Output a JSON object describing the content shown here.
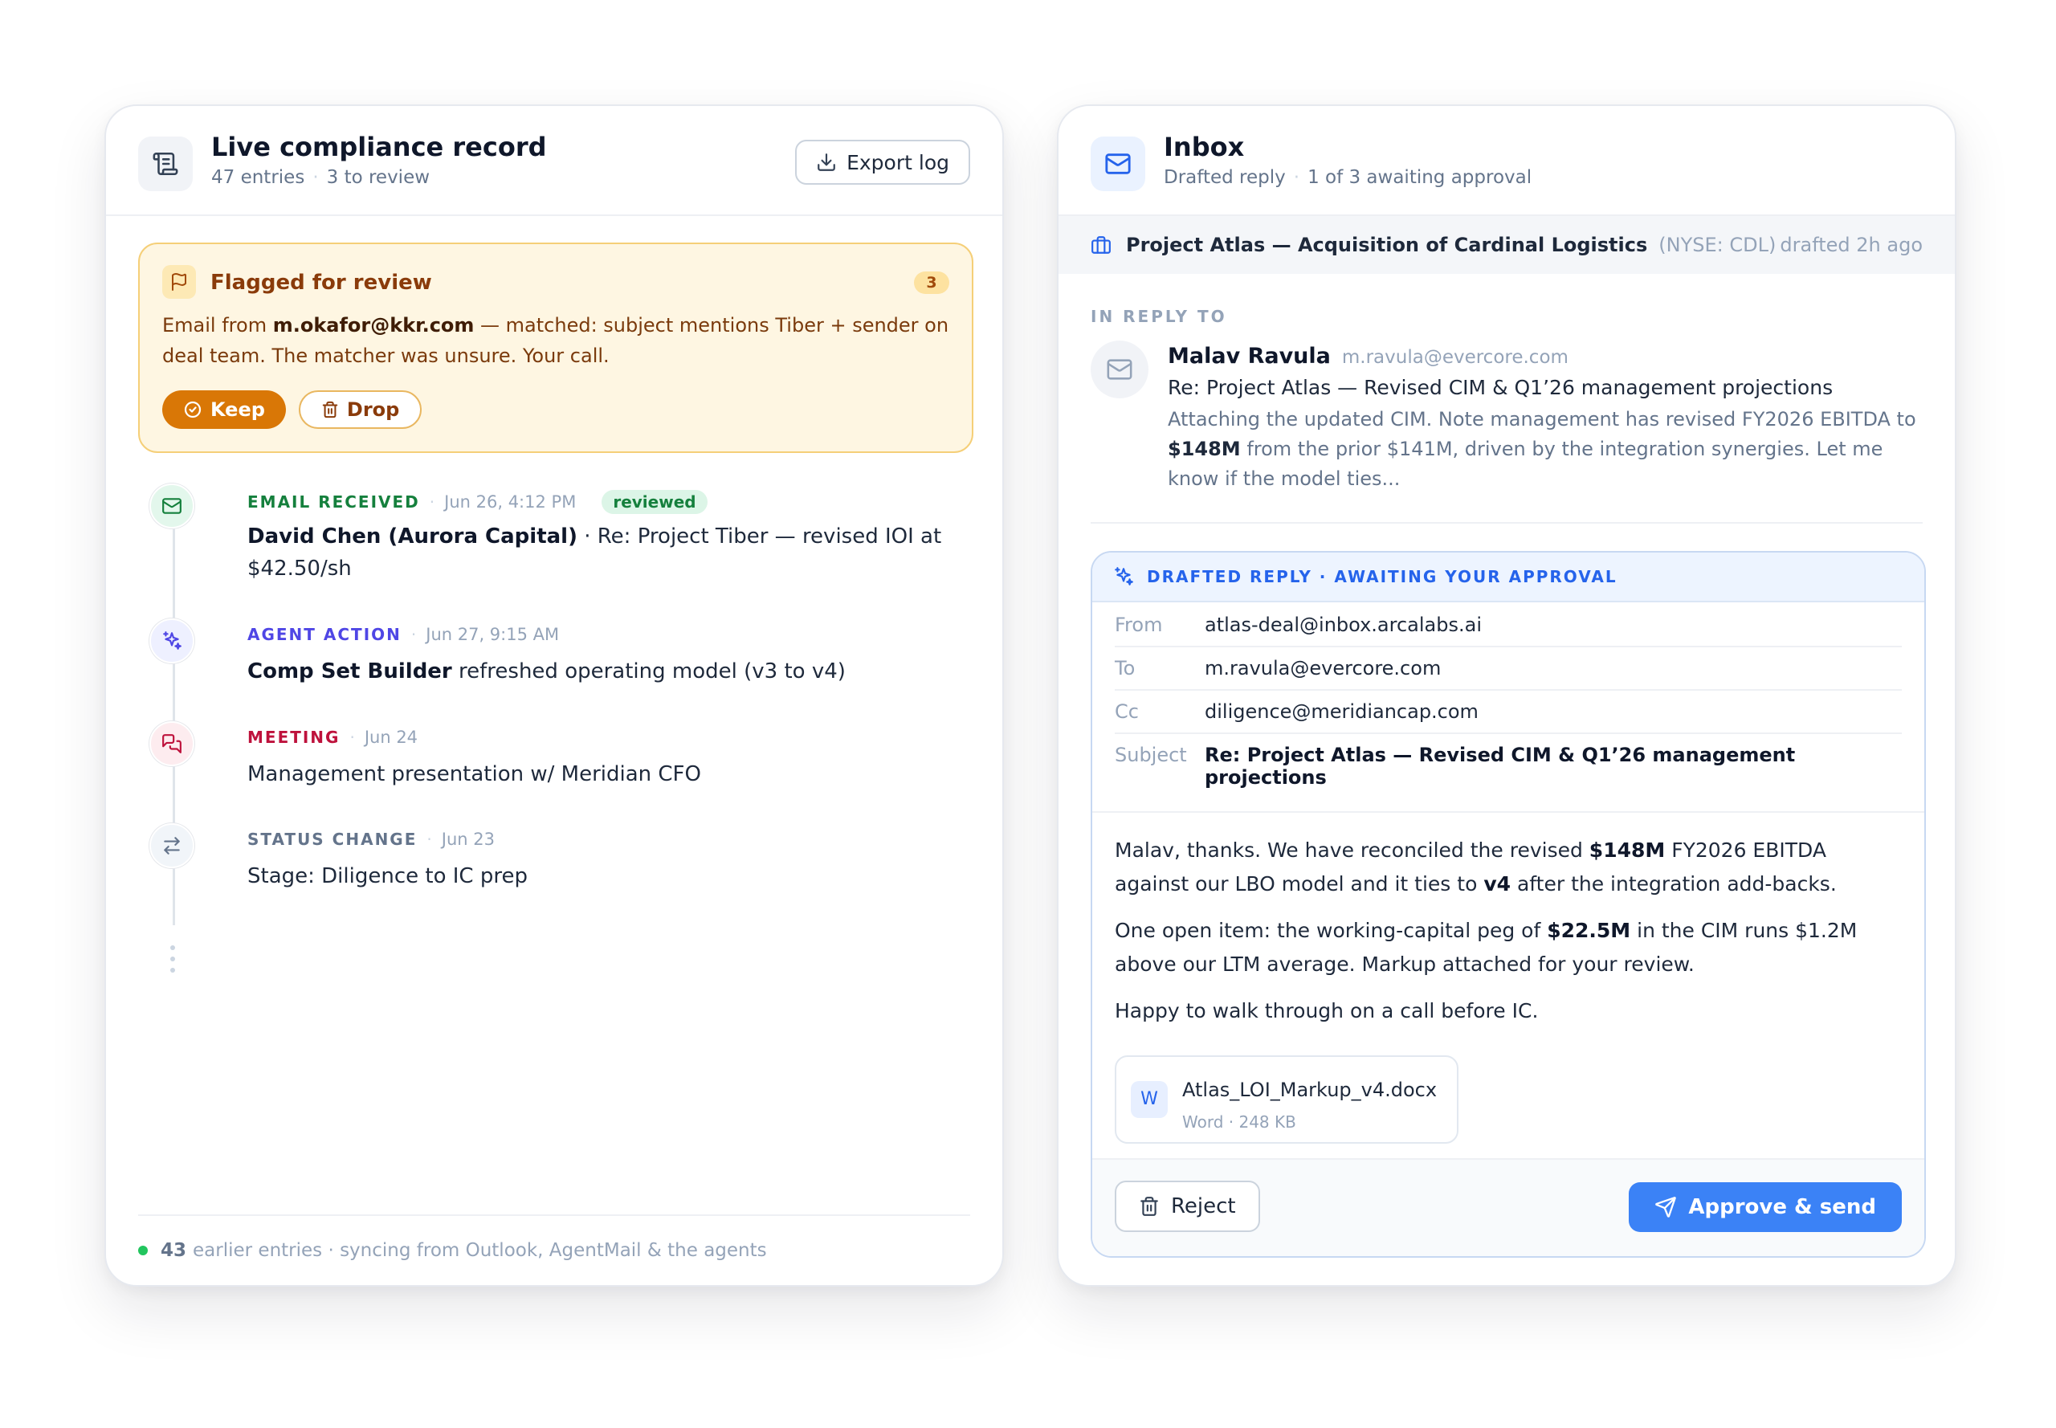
{
  "compliance": {
    "title": "Live compliance record",
    "entries": "47 entries",
    "to_review": "3 to review",
    "export_label": "Export log",
    "flag": {
      "title": "Flagged for review",
      "count": "3",
      "prefix": "Email from ",
      "sender": "m.okafor@kkr.com",
      "reason": " — matched: subject mentions Tiber + sender on deal team. The matcher was unsure. Your call.",
      "keep_label": "Keep",
      "drop_label": "Drop"
    },
    "timeline": [
      {
        "type": "EMAIL RECEIVED",
        "date": "Jun 26, 4:12 PM",
        "badge": "reviewed",
        "bold": "David Chen (Aurora Capital)",
        "text": " · Re: Project Tiber — revised IOI at $42.50/sh",
        "color": "#15803d"
      },
      {
        "type": "AGENT ACTION",
        "date": "Jun 27, 9:15 AM",
        "bold": "Comp Set Builder",
        "text": " refreshed operating model (v3 to v4)",
        "color": "#4f46e5"
      },
      {
        "type": "MEETING",
        "date": "Jun 24",
        "text": "Management presentation w/ Meridian CFO",
        "color": "#be123c"
      },
      {
        "type": "STATUS CHANGE",
        "date": "Jun 23",
        "text": "Stage: Diligence to IC prep",
        "color": "#64748b"
      }
    ],
    "footer_count": "43",
    "footer_text": "earlier entries · syncing from Outlook, AgentMail & the agents"
  },
  "inbox": {
    "title": "Inbox",
    "sub1": "Drafted reply",
    "sub2": "1 of 3 awaiting approval",
    "deal_name": "Project Atlas — Acquisition of Cardinal Logistics",
    "deal_ticker": "(NYSE: CDL)",
    "deal_time": "drafted 2h ago",
    "in_reply_label": "IN REPLY TO",
    "orig_name": "Malav Ravula",
    "orig_email": "m.ravula@evercore.com",
    "orig_subject": "Re: Project Atlas — Revised CIM & Q1’26 management projections",
    "orig_body_1": "Attaching the updated CIM. Note management has revised FY2026 EBITDA to ",
    "orig_body_bold": "$148M",
    "orig_body_2": " from the prior $141M, driven by the integration synergies. Let me know if the model ties...",
    "draft_header": "DRAFTED REPLY · AWAITING YOUR APPROVAL",
    "from_label": "From",
    "from_value": "atlas-deal@inbox.arcalabs.ai",
    "to_label": "To",
    "to_value": "m.ravula@evercore.com",
    "cc_label": "Cc",
    "cc_value": "diligence@meridiancap.com",
    "subject_label": "Subject",
    "subject_value": "Re: Project Atlas — Revised CIM & Q1’26 management projections",
    "p1_a": "Malav, thanks. We have reconciled the revised ",
    "p1_b": "$148M",
    "p1_c": " FY2026 EBITDA against our LBO model and it ties to ",
    "p1_d": "v4",
    "p1_e": " after the integration add-backs.",
    "p2_a": "One open item: the working-capital peg of ",
    "p2_b": "$22.5M",
    "p2_c": " in the CIM runs $1.2M above our LTM average. Markup attached for your review.",
    "p3": "Happy to walk through on a call before IC.",
    "attachment_icon": "W",
    "attachment_name": "Atlas_LOI_Markup_v4.docx",
    "attachment_meta": "Word · 248 KB",
    "reject_label": "Reject",
    "approve_label": "Approve & send"
  },
  "icons": {
    "compliance_header": "scroll-icon",
    "export": "download-icon",
    "flag": "flag-icon",
    "keep": "check-circle-icon",
    "drop": "trash-icon",
    "email": "mail-icon",
    "agent": "sparkles-icon",
    "meeting": "chat-icon",
    "status": "swap-arrows-icon",
    "inbox_header": "mail-icon",
    "deal": "briefcase-icon",
    "draft": "sparkles-icon",
    "reject": "trash-icon",
    "approve": "send-icon"
  },
  "colors": {
    "accent_blue": "#3b82f6",
    "flag_bg": "#fef6e2",
    "keep_orange": "#d97706",
    "success_green": "#22c55e"
  }
}
